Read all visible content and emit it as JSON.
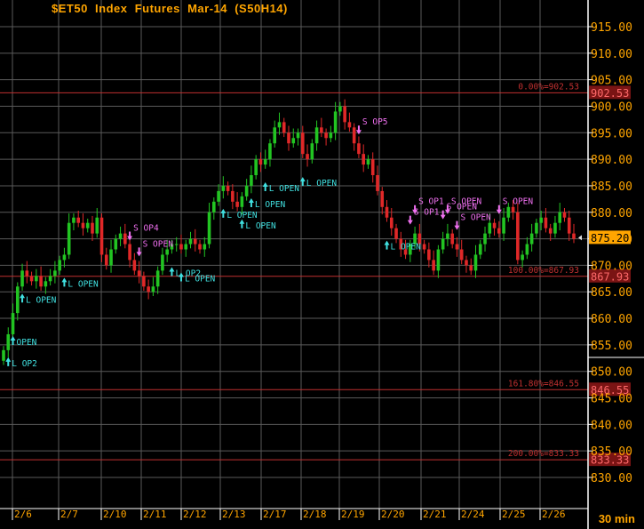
{
  "chart_data": {
    "type": "candlestick",
    "title": "$ET50  Index  Futures  Mar-14  (S50H14)",
    "timeframe": "30  min",
    "ylim": [
      825,
      920
    ],
    "y_ticks": [
      "830.00",
      "835.00",
      "840.00",
      "845.00",
      "850.00",
      "855.00",
      "860.00",
      "865.00",
      "870.00",
      "875.00",
      "880.00",
      "885.00",
      "890.00",
      "895.00",
      "900.00",
      "905.00",
      "910.00",
      "915.00"
    ],
    "x_labels": [
      "2/6",
      "2/7",
      "2/10",
      "2/11",
      "2/12",
      "2/13",
      "2/17",
      "2/18",
      "2/19",
      "2/20",
      "2/21",
      "2/24",
      "2/25",
      "2/26"
    ],
    "fib_levels": [
      {
        "label": "0.00%=902.53",
        "value": 902.53,
        "tag": "902.53"
      },
      {
        "label": "100.00%=867.93",
        "value": 867.93,
        "tag": "867.93"
      },
      {
        "label": "161.80%=846.55",
        "value": 846.55,
        "tag": "846.55"
      },
      {
        "label": "200.00%=833.33",
        "value": 833.33,
        "tag": "833.33"
      }
    ],
    "last_price": {
      "value": 875.2,
      "tag": "875.20"
    },
    "closes": [
      854,
      857,
      861,
      866,
      869,
      868,
      867,
      868,
      866,
      867,
      868,
      869,
      871,
      872,
      878,
      879,
      878,
      877,
      878,
      876,
      879,
      872,
      870,
      873,
      875,
      876,
      874,
      871,
      869,
      868,
      866,
      865,
      866,
      869,
      872,
      873,
      874,
      874,
      873,
      874,
      875,
      874,
      873,
      874,
      880,
      882,
      884,
      885,
      884,
      882,
      881,
      883,
      885,
      887,
      890,
      889,
      890,
      893,
      896,
      897,
      895,
      893,
      894,
      895,
      891,
      890,
      893,
      896,
      895,
      894,
      895,
      899,
      900,
      897,
      896,
      893,
      891,
      889,
      890,
      887,
      884,
      881,
      879,
      877,
      875,
      873,
      872,
      874,
      876,
      874,
      873,
      871,
      869,
      873,
      875,
      876,
      874,
      873,
      871,
      870,
      869,
      872,
      874,
      876,
      878,
      877,
      876,
      879,
      881,
      880,
      871,
      872,
      874,
      876,
      878,
      879,
      877,
      876,
      878,
      880,
      879,
      876,
      875
    ],
    "signals": [
      {
        "side": "long",
        "label": "L  OP2",
        "bar": 1
      },
      {
        "side": "long",
        "label": "OPEN",
        "bar": 2
      },
      {
        "side": "long",
        "label": "L  OPEN",
        "bar": 4
      },
      {
        "side": "long",
        "label": "L  OPEN",
        "bar": 13
      },
      {
        "side": "short",
        "label": "S  OP4",
        "bar": 27
      },
      {
        "side": "short",
        "label": "S  OPEN",
        "bar": 29
      },
      {
        "side": "long",
        "label": "L  OP2",
        "bar": 36
      },
      {
        "side": "long",
        "label": "L  OPEN",
        "bar": 38
      },
      {
        "side": "long",
        "label": "L  OPEN",
        "bar": 47
      },
      {
        "side": "long",
        "label": "L  OPEN",
        "bar": 51
      },
      {
        "side": "long",
        "label": "L  OPEN",
        "bar": 53
      },
      {
        "side": "long",
        "label": "L  OPEN",
        "bar": 56
      },
      {
        "side": "long",
        "label": "L  OPEN",
        "bar": 64
      },
      {
        "side": "short",
        "label": "S  OP5",
        "bar": 76
      },
      {
        "side": "long",
        "label": "L  OPEN",
        "bar": 82
      },
      {
        "side": "short",
        "label": "S  OP1",
        "bar": 87
      },
      {
        "side": "short",
        "label": "S  OP1",
        "bar": 88
      },
      {
        "side": "short",
        "label": "S  OPEN",
        "bar": 94
      },
      {
        "side": "short",
        "label": "S  OPEN",
        "bar": 95
      },
      {
        "side": "short",
        "label": "S  OPEN",
        "bar": 97
      },
      {
        "side": "short",
        "label": "S  OPEN",
        "bar": 106
      },
      {
        "side": "short",
        "label": "S  OPEN",
        "bar": 128
      }
    ]
  },
  "colors": {
    "background": "#000000",
    "grid": "#5a5a5a",
    "up": "#22c422",
    "down": "#e02828",
    "fib": "#c03030",
    "axis_text": "#ffa500",
    "long_signal": "#40e0e0",
    "short_signal": "#f070f0"
  }
}
